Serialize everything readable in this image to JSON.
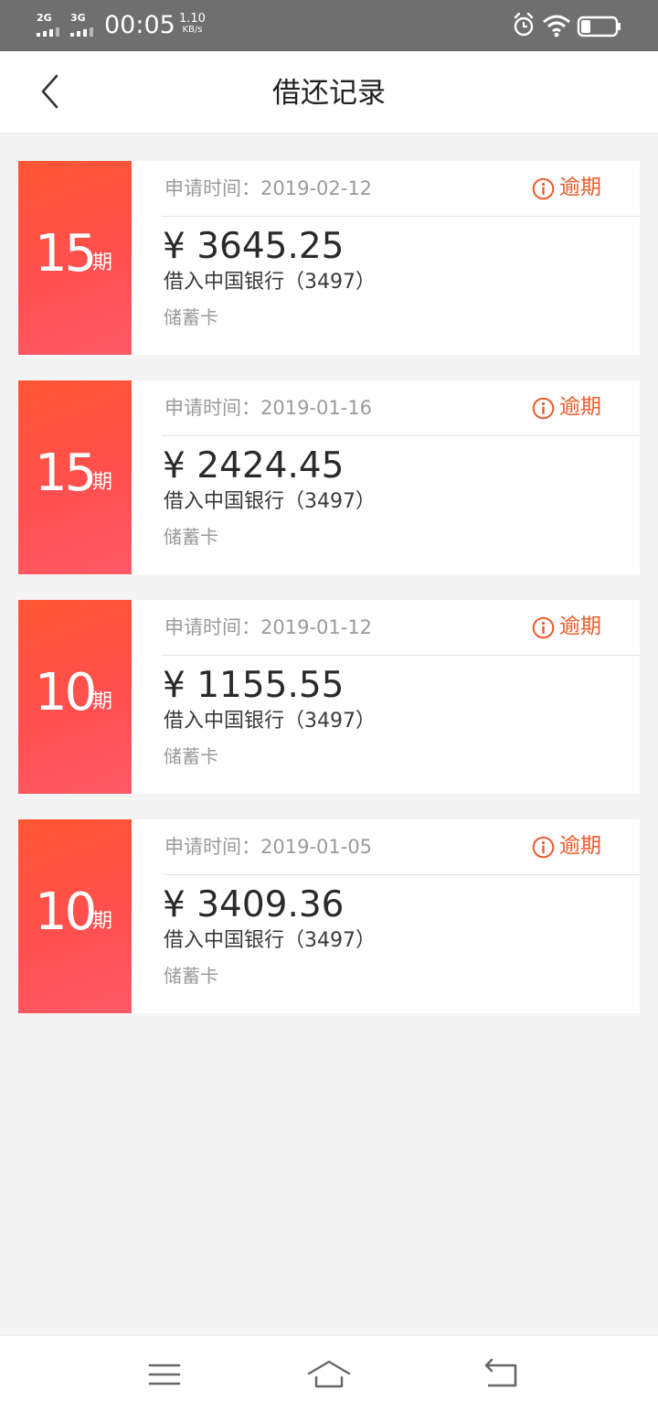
{
  "status_bar": {
    "sim1_network": "2G",
    "sim2_network": "3G",
    "time": "00:05",
    "speed_value": "1.10",
    "speed_unit": "KB/s",
    "icons": [
      "alarm-icon",
      "wifi-icon",
      "battery-icon"
    ]
  },
  "header": {
    "title": "借还记录",
    "back_icon": "chevron-left-icon"
  },
  "records": [
    {
      "term_num": "15",
      "term_unit": "期",
      "date_label": "申请时间：2019-02-12",
      "status": "逾期",
      "amount": "¥ 3645.25",
      "bank": "借入中国银行（3497）",
      "card_type": "储蓄卡"
    },
    {
      "term_num": "15",
      "term_unit": "期",
      "date_label": "申请时间：2019-01-16",
      "status": "逾期",
      "amount": "¥ 2424.45",
      "bank": "借入中国银行（3497）",
      "card_type": "储蓄卡"
    },
    {
      "term_num": "10",
      "term_unit": "期",
      "date_label": "申请时间：2019-01-12",
      "status": "逾期",
      "amount": "¥ 1155.55",
      "bank": "借入中国银行（3497）",
      "card_type": "储蓄卡"
    },
    {
      "term_num": "10",
      "term_unit": "期",
      "date_label": "申请时间：2019-01-05",
      "status": "逾期",
      "amount": "¥ 3409.36",
      "bank": "借入中国银行（3497）",
      "card_type": "储蓄卡"
    }
  ],
  "nav_bar": {
    "icons": [
      "menu-icon",
      "home-icon",
      "back-icon"
    ]
  },
  "colors": {
    "accent": "#f05a2a",
    "term_gradient_top": "#ff5632",
    "term_gradient_bottom": "#ff5a6a",
    "status_bar": "#6f6f6f",
    "page_background": "#f4f4f4"
  }
}
